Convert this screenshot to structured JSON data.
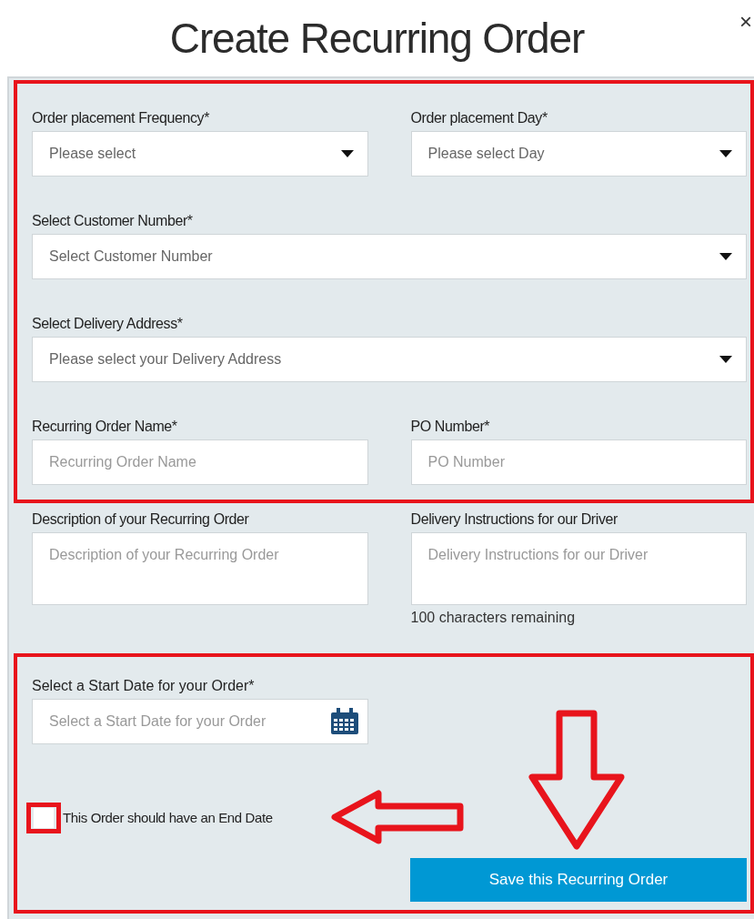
{
  "title": "Create Recurring Order",
  "close": "×",
  "sections": [
    {
      "highlighted": true,
      "rows": [
        [
          {
            "kind": "select",
            "label": "Order placement Frequency*",
            "placeholder": "Please select"
          },
          {
            "kind": "select",
            "label": "Order placement Day*",
            "placeholder": "Please select Day"
          }
        ],
        [
          {
            "kind": "select",
            "label": "Select Customer Number*",
            "placeholder": "Select Customer Number"
          }
        ],
        [
          {
            "kind": "select",
            "label": "Select Delivery Address*",
            "placeholder": "Please select your Delivery Address"
          }
        ],
        [
          {
            "kind": "text",
            "label": "Recurring Order Name*",
            "placeholder": "Recurring Order Name"
          },
          {
            "kind": "text",
            "label": "PO Number*",
            "placeholder": "PO Number"
          }
        ]
      ]
    },
    {
      "highlighted": false,
      "rows": [
        [
          {
            "kind": "textarea",
            "label": "Description of your Recurring Order",
            "placeholder": "Description of your Recurring Order"
          },
          {
            "kind": "textarea",
            "label": "Delivery Instructions for our Driver",
            "placeholder": "Delivery Instructions for our Driver",
            "note": "100 characters remaining"
          }
        ]
      ]
    }
  ],
  "start_date": {
    "label": "Select a Start Date for your Order*",
    "placeholder": "Select a Start Date for your Order"
  },
  "end_date": {
    "label": "This Order should have an End Date",
    "checked": false
  },
  "save_button": "Save this Recurring Order"
}
